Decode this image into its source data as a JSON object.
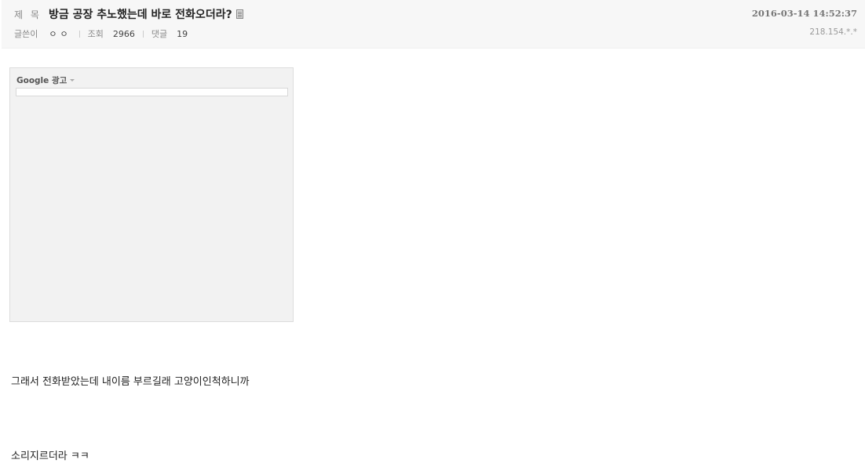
{
  "post": {
    "subject_label": "제 목",
    "title": "방금 공장 추노했는데 바로 전화오더라?",
    "date": "2016-03-14 14:52:37",
    "author_label": "글쓴이",
    "author": "ㅇㅇ",
    "views_label": "조회",
    "views": "2966",
    "comments_label": "댓글",
    "comments": "19",
    "ip": "218.154.*.*"
  },
  "ad": {
    "label": "Google 광고"
  },
  "content": {
    "line1": "그래서 전화받았는데 내이름 부르길래 고양이인척하니까",
    "line2": "소리지르더라 ㅋㅋ"
  }
}
